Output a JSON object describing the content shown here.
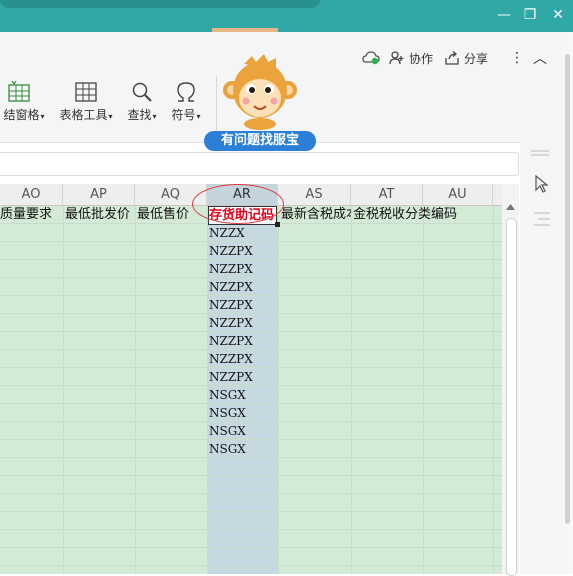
{
  "window": {
    "restore_glyph": "❐",
    "minimize_glyph": "—",
    "close_glyph": "✕"
  },
  "topbar": {
    "collab_label": "协作",
    "share_label": "分享",
    "more_glyph": "⋮",
    "collapse_glyph": "︿"
  },
  "ribbon": {
    "tools": [
      {
        "label": "结窗格",
        "icon": "freeze-pane-icon"
      },
      {
        "label": "表格工具",
        "icon": "table-tools-icon"
      },
      {
        "label": "查找",
        "icon": "search-icon"
      },
      {
        "label": "符号",
        "icon": "omega-icon"
      }
    ],
    "caret": "▾",
    "help_badge": "有问题找服宝"
  },
  "sheet": {
    "columns": [
      "AO",
      "AP",
      "AQ",
      "AR",
      "AS",
      "AT",
      "AU"
    ],
    "selected_column": "AR",
    "header_row": {
      "AO": "质量要求",
      "AP": "最低批发价",
      "AQ": "最低售价",
      "AR": "存货助记码",
      "AS": "最新含税成本",
      "AT": "金税税收分类编码",
      "AU": ""
    },
    "ar_values": [
      "NZZX",
      "NZZPX",
      "NZZPX",
      "NZZPX",
      "NZZPX",
      "NZZPX",
      "NZZPX",
      "NZZPX",
      "NZZPX",
      "NSGX",
      "NSGX",
      "NSGX",
      "NSGX"
    ]
  },
  "colors": {
    "titlebar": "#2fa8a6",
    "cell_fill": "#d3ead7",
    "selected_column": "#c6d9e1",
    "highlight_red": "#e0001b",
    "help_badge": "#2b7fd7"
  }
}
